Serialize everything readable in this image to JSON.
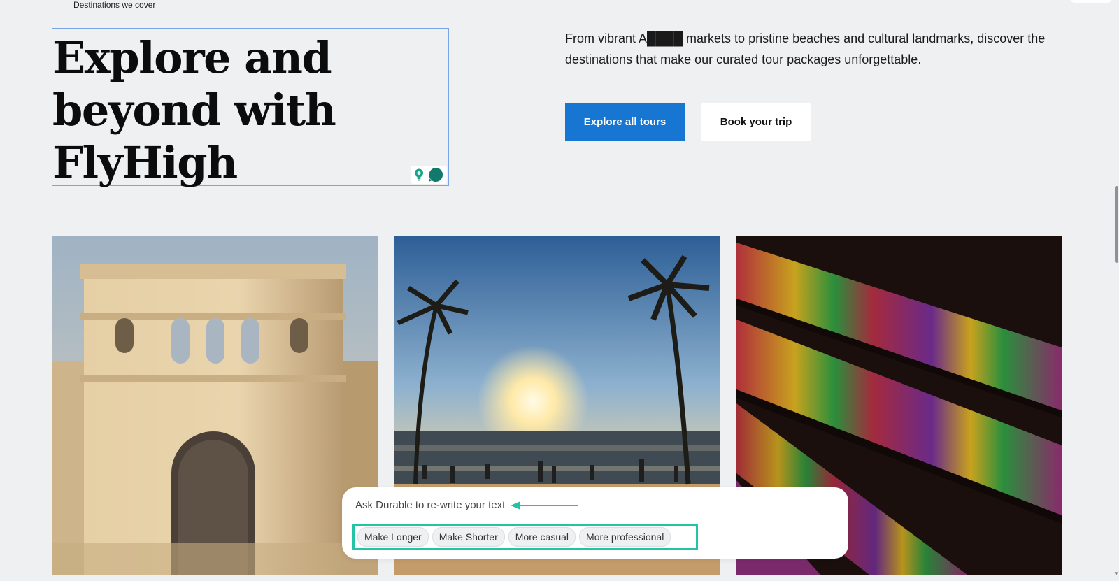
{
  "eyebrow": {
    "label": "Destinations we cover"
  },
  "hero": {
    "headline_lines": [
      "Explore and",
      "beyond with",
      "FlyHigh"
    ],
    "intro": "From vibrant A████ markets to pristine beaches and cultural landmarks, discover the destinations that make our curated tour packages unforgettable."
  },
  "buttons": {
    "primary": "Explore all tours",
    "secondary": "Book your trip"
  },
  "gallery": {
    "tiles": [
      "historic-fort-gate",
      "beach-sunset-palms",
      "woven-kente-cloth"
    ]
  },
  "ai_rewrite": {
    "prompt": "Ask Durable to re-write your text",
    "chips": [
      "Make Longer",
      "Make Shorter",
      "More casual",
      "More professional"
    ]
  },
  "colors": {
    "primary_button": "#1676d2",
    "highlight": "#23c4a6",
    "selection_border": "#7aa3e8",
    "background": "#eef0f2"
  }
}
